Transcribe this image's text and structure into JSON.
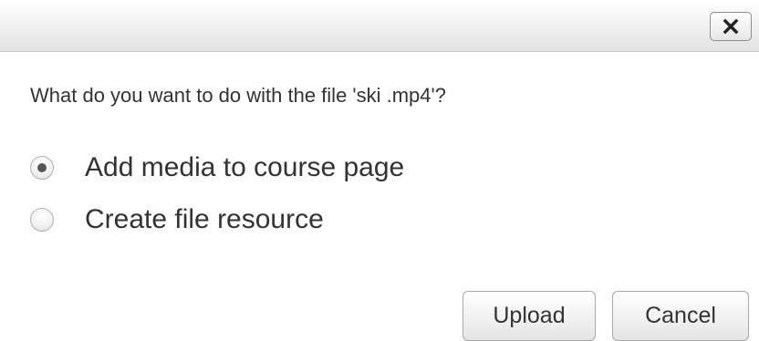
{
  "titlebar": {
    "close_icon": "close-icon"
  },
  "question": "What do you want to do with the file 'ski .mp4'?",
  "options": [
    {
      "label": "Add media to course page",
      "selected": true
    },
    {
      "label": "Create file resource",
      "selected": false
    }
  ],
  "buttons": {
    "upload": "Upload",
    "cancel": "Cancel"
  },
  "colors": {
    "text": "#333333",
    "border": "#a8a8a8",
    "radio_dot": "#555555"
  }
}
